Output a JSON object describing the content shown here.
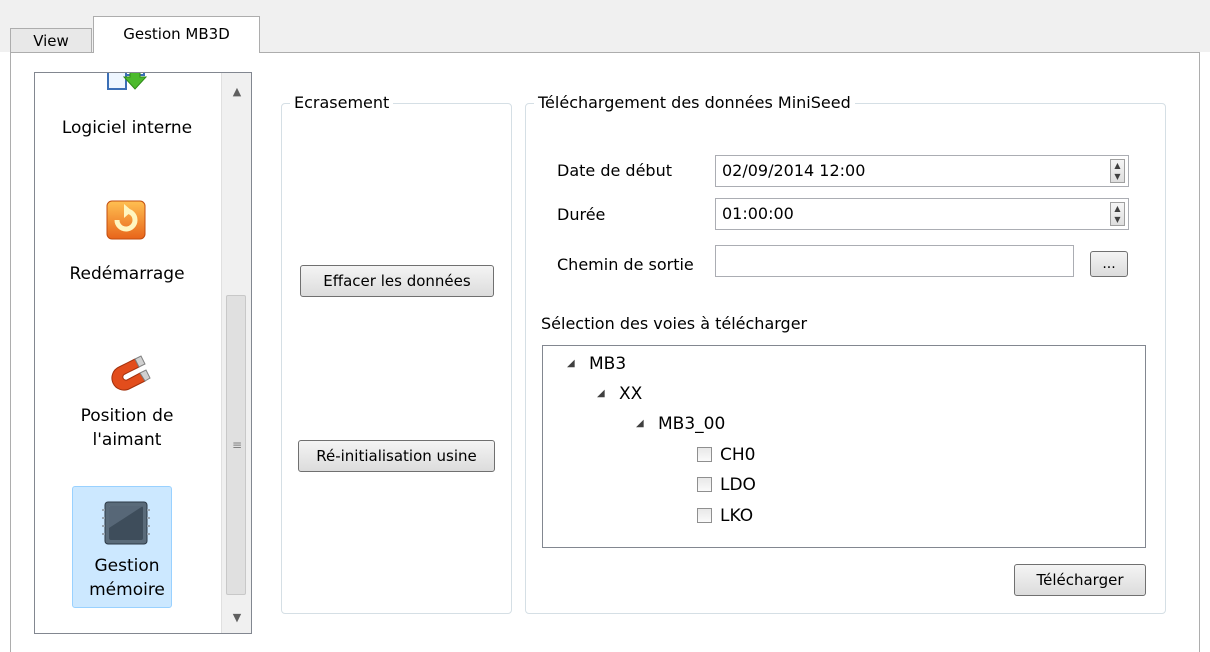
{
  "tabs": [
    {
      "label": "View"
    },
    {
      "label": "Gestion MB3D"
    }
  ],
  "sidebar": {
    "items": [
      {
        "label": "Logiciel interne",
        "icon": "download-arrow-icon"
      },
      {
        "label": "Redémarrage",
        "icon": "restart-icon"
      },
      {
        "label_line1": "Position de",
        "label_line2": "l'aimant",
        "icon": "magnet-icon"
      },
      {
        "label_line1": "Gestion",
        "label_line2": "mémoire",
        "icon": "memory-chip-icon",
        "selected": true
      }
    ]
  },
  "ecrasement": {
    "title": "Ecrasement",
    "erase_button": "Effacer les données",
    "reset_button": "Ré-initialisation usine"
  },
  "download": {
    "title": "Téléchargement des données MiniSeed",
    "start_date_label": "Date de début",
    "start_date_value": "02/09/2014 12:00",
    "duration_label": "Durée",
    "duration_value": "01:00:00",
    "output_path_label": "Chemin de sortie",
    "output_path_value": "",
    "browse_button": "...",
    "channels_label": "Sélection des voies à télécharger",
    "tree": {
      "root": "MB3",
      "network": "XX",
      "station": "MB3_00",
      "channels": [
        {
          "label": "CH0",
          "checked": false
        },
        {
          "label": "LDO",
          "checked": false
        },
        {
          "label": "LKO",
          "checked": false
        }
      ]
    },
    "submit_button": "Télécharger"
  },
  "colors": {
    "selection_bg": "#cce8ff",
    "selection_border": "#99d1ff",
    "groupbox_border": "#d5dfe5"
  }
}
